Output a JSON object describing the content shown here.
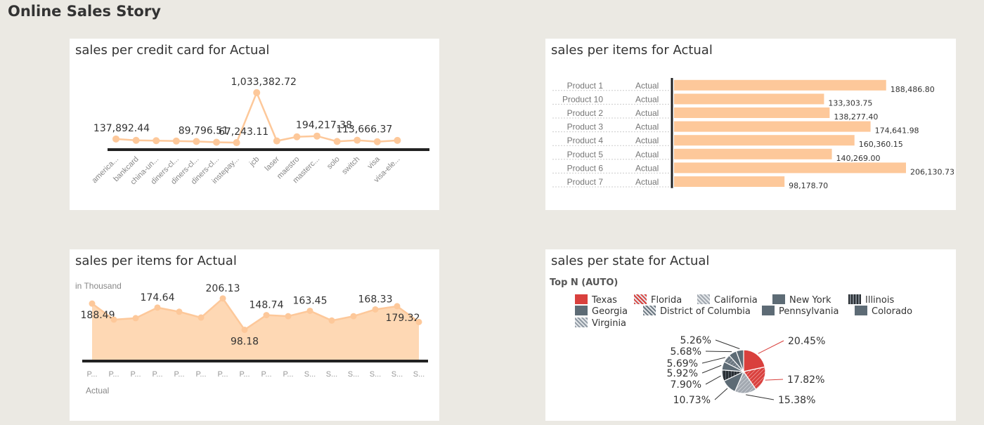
{
  "story": {
    "title": "Online Sales Story"
  },
  "cards": {
    "credit": {
      "title": "sales per credit card for Actual"
    },
    "items_bar": {
      "title": "sales per items for Actual"
    },
    "items_area": {
      "title": "sales per items for Actual",
      "unit": "in Thousand",
      "series_label": "Actual"
    },
    "state": {
      "title": "sales per state for Actual",
      "topn": "Top N (AUTO)"
    }
  },
  "colors": {
    "peach": "#fdc89a",
    "peach_area": "#fed8b4",
    "axis": "#222222"
  },
  "chart_data": [
    {
      "type": "line",
      "title": "sales per credit card for Actual",
      "categories": [
        "america...",
        "bankcard",
        "china-un...",
        "diners-cl...",
        "diners-cl...",
        "diners-cl...",
        "instepay...",
        "jcb",
        "laser",
        "maestro",
        "masterc...",
        "solo",
        "switch",
        "visa",
        "visa-ele..."
      ],
      "values": [
        137892.44,
        112000,
        105000,
        98000,
        89796.51,
        75000,
        67243.11,
        1033382.72,
        100000,
        180000,
        194217.38,
        90000,
        113666.37,
        85000,
        110000
      ],
      "labels": {
        "0": "137,892.44",
        "4": "89,796.51",
        "6": "67,243.11",
        "7": "1,033,382.72",
        "10": "194,217.38",
        "12": "113,666.37"
      },
      "ylim": [
        0,
        1100000
      ]
    },
    {
      "type": "bar",
      "orientation": "horizontal",
      "title": "sales per items for Actual",
      "categories": [
        "Product 1",
        "Product 10",
        "Product 2",
        "Product 3",
        "Product 4",
        "Product 5",
        "Product 6",
        "Product 7"
      ],
      "measure": "Actual",
      "values": [
        188486.8,
        133303.75,
        138277.4,
        174641.98,
        160360.15,
        140269.0,
        206130.73,
        98178.7
      ],
      "labels": [
        "188,486.80",
        "133,303.75",
        "138,277.40",
        "174,641.98",
        "160,360.15",
        "140,269.00",
        "206,130.73",
        "98,178.70"
      ]
    },
    {
      "type": "area",
      "title": "sales per items for Actual",
      "unit": "in Thousand",
      "series": [
        {
          "name": "Actual"
        }
      ],
      "categories": [
        "P...",
        "P...",
        "P...",
        "P...",
        "P...",
        "P...",
        "P...",
        "P...",
        "P...",
        "P...",
        "S...",
        "S...",
        "S...",
        "S...",
        "S...",
        "S..."
      ],
      "values": [
        188.49,
        133.3,
        138.28,
        174.64,
        160.36,
        140.27,
        206.13,
        98.18,
        148.74,
        145.0,
        163.45,
        130.0,
        145.0,
        168.33,
        179.32,
        125.0
      ],
      "labels": {
        "0": "188.49",
        "3": "174.64",
        "6": "206.13",
        "7": "98.18",
        "8": "148.74",
        "10": "163.45",
        "13": "168.33",
        "14": "179.32"
      },
      "ylim": [
        0,
        230
      ]
    },
    {
      "type": "pie",
      "title": "sales per state for Actual",
      "legend": [
        {
          "name": "Texas",
          "color": "#d9403d",
          "pattern": "solid"
        },
        {
          "name": "Florida",
          "color": "#d9403d",
          "pattern": "hatch"
        },
        {
          "name": "California",
          "color": "#a2a8b0",
          "pattern": "hatch"
        },
        {
          "name": "New York",
          "color": "#5d6b75",
          "pattern": "solid"
        },
        {
          "name": "Illinois",
          "color": "#2a2f34",
          "pattern": "stripe"
        },
        {
          "name": "Georgia",
          "color": "#5d6b75",
          "pattern": "solid"
        },
        {
          "name": "District of Columbia",
          "color": "#6a7680",
          "pattern": "hatch"
        },
        {
          "name": "Pennsylvania",
          "color": "#5d6b75",
          "pattern": "solid"
        },
        {
          "name": "Colorado",
          "color": "#5d6b75",
          "pattern": "solid"
        },
        {
          "name": "Virginia",
          "color": "#8e98a2",
          "pattern": "hatch"
        }
      ],
      "slices": [
        20.45,
        17.82,
        15.38,
        10.73,
        7.9,
        5.92,
        5.69,
        5.68,
        5.26
      ],
      "slice_labels": [
        "20.45%",
        "17.82%",
        "15.38%",
        "10.73%",
        "7.90%",
        "5.92%",
        "5.69%",
        "5.68%",
        "5.26%"
      ]
    }
  ]
}
